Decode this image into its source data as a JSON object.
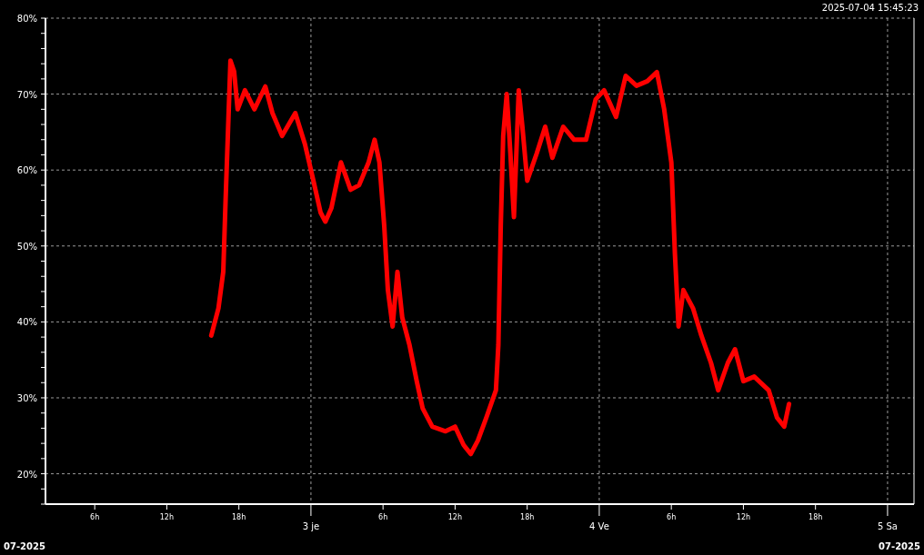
{
  "timestamp": "2025-07-04 15:45:23",
  "chart": {
    "chart_data": {
      "type": "line",
      "grid": true,
      "x": [
        "2025-07-02T15:42",
        "2025-07-02T16:18",
        "2025-07-02T16:42",
        "2025-07-02T16:54",
        "2025-07-02T17:00",
        "2025-07-02T17:18",
        "2025-07-02T17:36",
        "2025-07-02T17:54",
        "2025-07-02T18:30",
        "2025-07-02T19:18",
        "2025-07-02T20:12",
        "2025-07-02T20:48",
        "2025-07-02T21:36",
        "2025-07-02T22:42",
        "2025-07-02T23:30",
        "2025-07-03T00:12",
        "2025-07-03T00:48",
        "2025-07-03T01:12",
        "2025-07-03T01:42",
        "2025-07-03T02:30",
        "2025-07-03T03:18",
        "2025-07-03T04:00",
        "2025-07-03T04:48",
        "2025-07-03T05:18",
        "2025-07-03T05:42",
        "2025-07-03T06:06",
        "2025-07-03T06:24",
        "2025-07-03T06:48",
        "2025-07-03T07:12",
        "2025-07-03T07:36",
        "2025-07-03T08:12",
        "2025-07-03T08:48",
        "2025-07-03T09:18",
        "2025-07-03T10:06",
        "2025-07-03T11:12",
        "2025-07-03T12:00",
        "2025-07-03T12:42",
        "2025-07-03T13:18",
        "2025-07-03T13:54",
        "2025-07-03T14:36",
        "2025-07-03T15:24",
        "2025-07-03T15:36",
        "2025-07-03T15:48",
        "2025-07-03T16:00",
        "2025-07-03T16:18",
        "2025-07-03T16:36",
        "2025-07-03T16:54",
        "2025-07-03T17:18",
        "2025-07-03T17:36",
        "2025-07-03T18:00",
        "2025-07-03T18:48",
        "2025-07-03T19:30",
        "2025-07-03T20:06",
        "2025-07-03T21:00",
        "2025-07-03T21:54",
        "2025-07-03T22:54",
        "2025-07-03T23:42",
        "2025-07-04T00:24",
        "2025-07-04T01:24",
        "2025-07-04T02:12",
        "2025-07-04T03:06",
        "2025-07-04T04:00",
        "2025-07-04T04:48",
        "2025-07-04T05:24",
        "2025-07-04T06:00",
        "2025-07-04T06:18",
        "2025-07-04T06:36",
        "2025-07-04T07:00",
        "2025-07-04T07:48",
        "2025-07-04T08:30",
        "2025-07-04T09:18",
        "2025-07-04T09:54",
        "2025-07-04T10:42",
        "2025-07-04T11:18",
        "2025-07-04T12:00",
        "2025-07-04T12:54",
        "2025-07-04T14:06",
        "2025-07-04T14:48",
        "2025-07-04T15:24",
        "2025-07-04T15:48"
      ],
      "series": [
        {
          "color": "#ff0000",
          "values": [
            38.2,
            41.8,
            46.6,
            56.2,
            61.0,
            74.4,
            73.0,
            68.0,
            70.5,
            68.0,
            71.0,
            67.5,
            64.5,
            67.5,
            63.4,
            58.6,
            54.4,
            53.2,
            55.0,
            61.0,
            57.4,
            58.0,
            61.0,
            64.0,
            61.0,
            52.6,
            44.2,
            39.4,
            46.6,
            40.6,
            37.0,
            32.2,
            28.6,
            26.2,
            25.6,
            26.2,
            23.8,
            22.6,
            24.4,
            27.4,
            31.0,
            37.0,
            52.6,
            64.5,
            70.0,
            62.2,
            53.8,
            70.5,
            65.7,
            58.6,
            62.2,
            65.7,
            61.6,
            65.7,
            64.0,
            64.0,
            69.3,
            70.5,
            67.0,
            72.4,
            71.1,
            71.7,
            72.9,
            68.0,
            61.0,
            49.0,
            39.4,
            44.2,
            41.8,
            38.2,
            34.6,
            31.0,
            34.6,
            36.4,
            32.2,
            32.8,
            31.0,
            27.4,
            26.2,
            29.2
          ]
        }
      ],
      "xlim": [
        "2025-07-02T01:54",
        "2025-07-05T02:12"
      ],
      "ylim": [
        16,
        80
      ],
      "xticks": [
        {
          "value": "2025-07-02T06:00",
          "label": "6h"
        },
        {
          "value": "2025-07-02T12:00",
          "label": "12h"
        },
        {
          "value": "2025-07-02T18:00",
          "label": "18h"
        },
        {
          "value": "2025-07-03T06:00",
          "label": "6h"
        },
        {
          "value": "2025-07-03T12:00",
          "label": "12h"
        },
        {
          "value": "2025-07-03T18:00",
          "label": "18h"
        },
        {
          "value": "2025-07-04T06:00",
          "label": "6h"
        },
        {
          "value": "2025-07-04T12:00",
          "label": "12h"
        },
        {
          "value": "2025-07-04T18:00",
          "label": "18h"
        }
      ],
      "yticks": [
        {
          "value": 20,
          "label": "20%"
        },
        {
          "value": 30,
          "label": "30%"
        },
        {
          "value": 40,
          "label": "40%"
        },
        {
          "value": 50,
          "label": "50%"
        },
        {
          "value": 60,
          "label": "60%"
        },
        {
          "value": 70,
          "label": "70%"
        },
        {
          "value": 80,
          "label": "80%"
        }
      ]
    },
    "day_labels": [
      "3 je",
      "4 Ve",
      "5 Sa"
    ]
  },
  "footer": {
    "left": "07-2025",
    "right": "07-2025"
  }
}
